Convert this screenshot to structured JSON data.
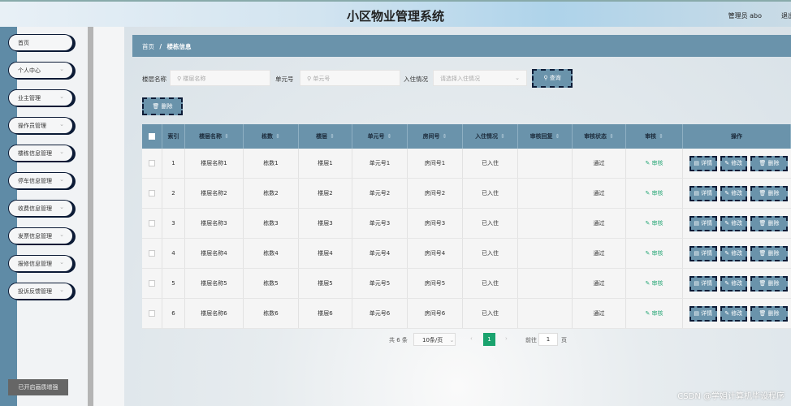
{
  "header": {
    "title": "小区物业管理系统",
    "user": "管理员 abo",
    "logout": "退出"
  },
  "sidebar": {
    "items": [
      {
        "label": "首页",
        "chevron": false
      },
      {
        "label": "个人中心",
        "chevron": true
      },
      {
        "label": "业主管理",
        "chevron": true
      },
      {
        "label": "操作员管理",
        "chevron": true
      },
      {
        "label": "楼栋信息管理",
        "chevron": true
      },
      {
        "label": "停车信息管理",
        "chevron": true
      },
      {
        "label": "收费信息管理",
        "chevron": true
      },
      {
        "label": "发票信息管理",
        "chevron": true
      },
      {
        "label": "报修信息管理",
        "chevron": true
      },
      {
        "label": "投诉反馈管理",
        "chevron": true
      }
    ],
    "enhance_label": "已开启画质增强"
  },
  "breadcrumb": {
    "home": "首页",
    "sep": "/",
    "current": "楼栋信息"
  },
  "search": {
    "floor_label": "楼层名称",
    "floor_placeholder": "楼层名称",
    "unit_label": "单元号",
    "unit_placeholder": "单元号",
    "status_label": "入住情况",
    "status_placeholder": "请选择入住情况",
    "query_button": "查询"
  },
  "toolbar": {
    "delete_button": "删除"
  },
  "table": {
    "columns": [
      "索引",
      "楼层名称",
      "栋数",
      "楼层",
      "单元号",
      "房间号",
      "入住情况",
      "审核回复",
      "审核状态",
      "审核",
      "操作"
    ],
    "rows": [
      [
        "1",
        "楼层名称1",
        "栋数1",
        "楼层1",
        "单元号1",
        "房间号1",
        "已入住",
        "",
        "通过"
      ],
      [
        "2",
        "楼层名称2",
        "栋数2",
        "楼层2",
        "单元号2",
        "房间号2",
        "已入住",
        "",
        "通过"
      ],
      [
        "3",
        "楼层名称3",
        "栋数3",
        "楼层3",
        "单元号3",
        "房间号3",
        "已入住",
        "",
        "通过"
      ],
      [
        "4",
        "楼层名称4",
        "栋数4",
        "楼层4",
        "单元号4",
        "房间号4",
        "已入住",
        "",
        "通过"
      ],
      [
        "5",
        "楼层名称5",
        "栋数5",
        "楼层5",
        "单元号5",
        "房间号5",
        "已入住",
        "",
        "通过"
      ],
      [
        "6",
        "楼层名称6",
        "栋数6",
        "楼层6",
        "单元号6",
        "房间号6",
        "已入住",
        "",
        "通过"
      ]
    ],
    "audit_link": "审核",
    "actions": {
      "detail": "详情",
      "edit": "修改",
      "delete": "删除"
    }
  },
  "pagination": {
    "total": "共 6 条",
    "page_size": "10条/页",
    "current_page": "1",
    "goto_label": "前往",
    "goto_value": "1",
    "page_unit": "页"
  },
  "watermark": "CSDN @学姐计算机毕设程序",
  "colors": {
    "accent": "#6a93ab",
    "border_dark": "#0c1b36",
    "active_page": "#1aa36e",
    "audit_link": "#2aa878"
  }
}
